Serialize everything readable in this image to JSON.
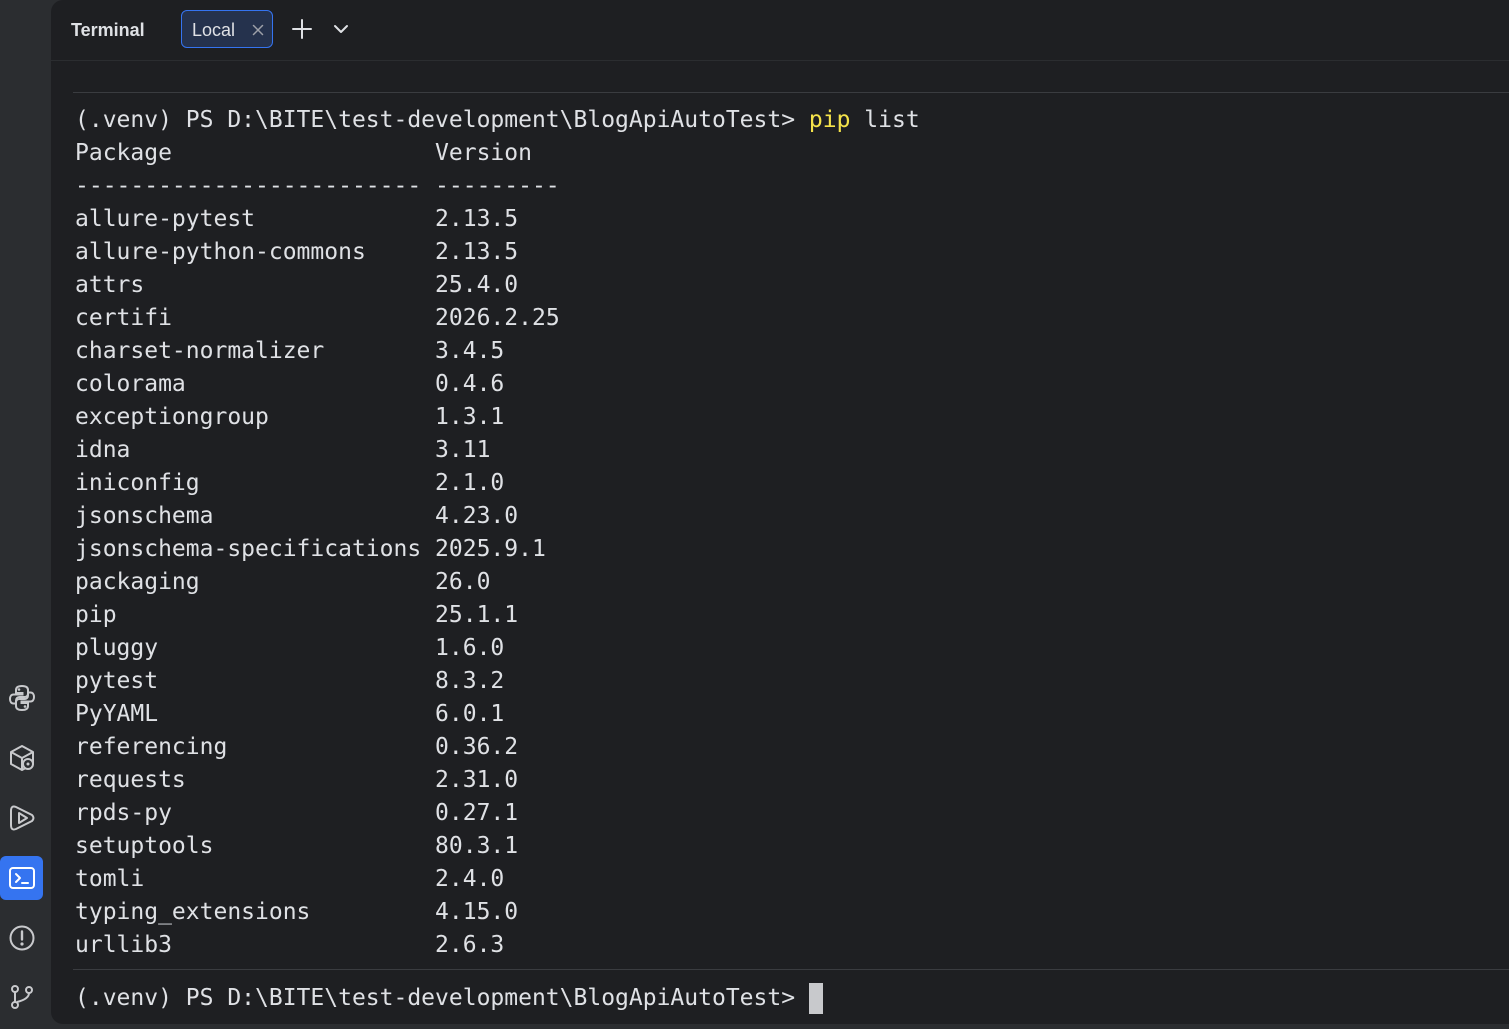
{
  "tool_window": {
    "title": "Terminal",
    "tab_label": "Local"
  },
  "terminal": {
    "command_prompt": "(.venv) PS D:\\BITE\\test-development\\BlogApiAutoTest> ",
    "command_pip": "pip",
    "command_args": " list",
    "header_line": "Package                   Version",
    "separator_line": "------------------------- ---------",
    "packages": [
      {
        "name": "allure-pytest",
        "version": "2.13.5"
      },
      {
        "name": "allure-python-commons",
        "version": "2.13.5"
      },
      {
        "name": "attrs",
        "version": "25.4.0"
      },
      {
        "name": "certifi",
        "version": "2026.2.25"
      },
      {
        "name": "charset-normalizer",
        "version": "3.4.5"
      },
      {
        "name": "colorama",
        "version": "0.4.6"
      },
      {
        "name": "exceptiongroup",
        "version": "1.3.1"
      },
      {
        "name": "idna",
        "version": "3.11"
      },
      {
        "name": "iniconfig",
        "version": "2.1.0"
      },
      {
        "name": "jsonschema",
        "version": "4.23.0"
      },
      {
        "name": "jsonschema-specifications",
        "version": "2025.9.1"
      },
      {
        "name": "packaging",
        "version": "26.0"
      },
      {
        "name": "pip",
        "version": "25.1.1"
      },
      {
        "name": "pluggy",
        "version": "1.6.0"
      },
      {
        "name": "pytest",
        "version": "8.3.2"
      },
      {
        "name": "PyYAML",
        "version": "6.0.1"
      },
      {
        "name": "referencing",
        "version": "0.36.2"
      },
      {
        "name": "requests",
        "version": "2.31.0"
      },
      {
        "name": "rpds-py",
        "version": "0.27.1"
      },
      {
        "name": "setuptools",
        "version": "80.3.1"
      },
      {
        "name": "tomli",
        "version": "2.4.0"
      },
      {
        "name": "typing_extensions",
        "version": "4.15.0"
      },
      {
        "name": "urllib3",
        "version": "2.6.3"
      }
    ],
    "current_prompt": "(.venv) PS D:\\BITE\\test-development\\BlogApiAutoTest>"
  },
  "icons": {
    "toolbar": [
      "add-icon",
      "chevron-down-icon"
    ],
    "tab": [
      "close-icon"
    ],
    "left_strip": [
      "python-icon",
      "python-packages-icon",
      "run-icon",
      "terminal-icon",
      "problems-icon",
      "git-icon"
    ]
  },
  "colors": {
    "active_accent": "#3574f0",
    "command_highlight": "#f5e34a",
    "panel_background": "#1e1f22"
  }
}
